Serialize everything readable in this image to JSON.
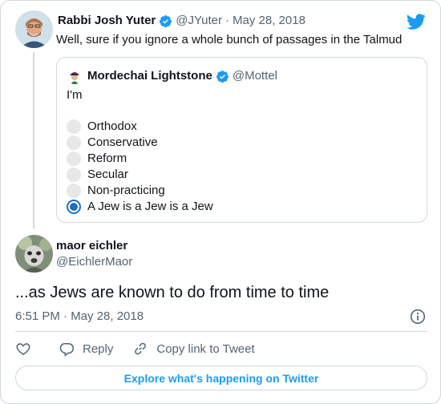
{
  "parent_tweet": {
    "name": "Rabbi Josh Yuter",
    "handle": "@JYuter",
    "date": "May 28, 2018",
    "text": "Well, sure if you ignore a whole bunch of passages in the Talmud"
  },
  "quoted_tweet": {
    "name": "Mordechai Lightstone",
    "handle": "@Mottel",
    "text": "I'm",
    "poll_options": [
      {
        "label": "Orthodox",
        "selected": false
      },
      {
        "label": "Conservative",
        "selected": false
      },
      {
        "label": "Reform",
        "selected": false
      },
      {
        "label": "Secular",
        "selected": false
      },
      {
        "label": "Non-practicing",
        "selected": false
      },
      {
        "label": "A Jew is a Jew is a Jew",
        "selected": true
      }
    ]
  },
  "main_tweet": {
    "name": "maor eichler",
    "handle": "@EichlerMaor",
    "text": "...as Jews are known to do from time to time",
    "timestamp": "6:51 PM · May 28, 2018"
  },
  "actions": {
    "like_icon": "heart-icon",
    "reply_label": "Reply",
    "copy_link_label": "Copy link to Tweet"
  },
  "explore_label": "Explore what's happening on Twitter",
  "colors": {
    "brand_blue": "#1d9bf0",
    "verified_blue": "#1d9bf0",
    "poll_selected": "#1d6fb8",
    "muted_text": "#536471",
    "border": "#cfd9de"
  }
}
